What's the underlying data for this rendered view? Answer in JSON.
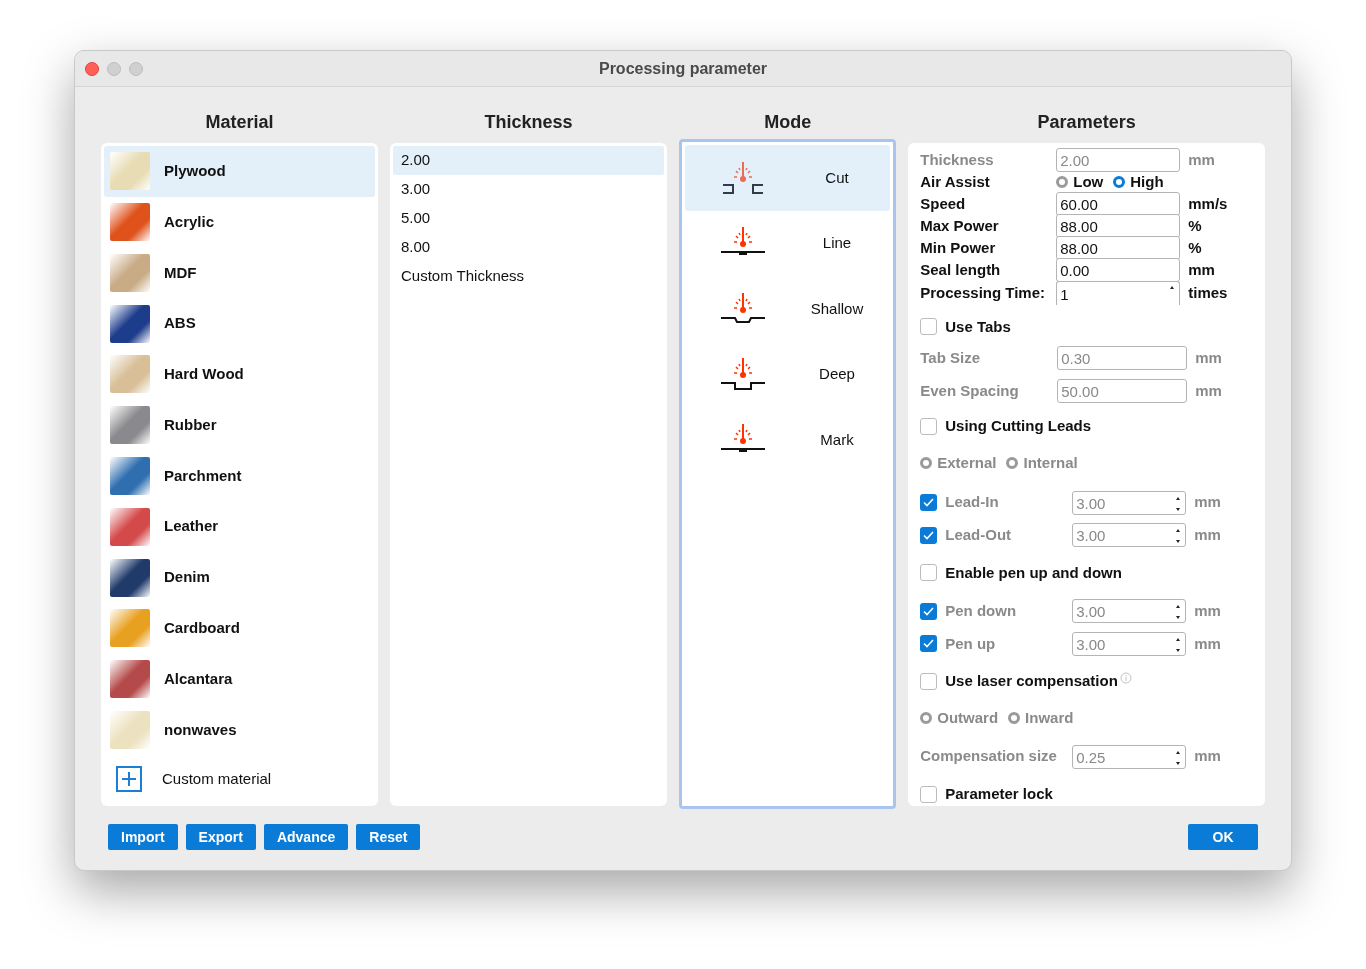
{
  "window": {
    "title": "Processing parameter"
  },
  "material": {
    "heading": "Material",
    "items": [
      {
        "name": "Plywood",
        "selected": true,
        "color": "#e8dcb4"
      },
      {
        "name": "Acrylic",
        "selected": false,
        "color": "#e0521c"
      },
      {
        "name": "MDF",
        "selected": false,
        "color": "#c9ac86"
      },
      {
        "name": "ABS",
        "selected": false,
        "color": "#1d3c8c"
      },
      {
        "name": "Hard Wood",
        "selected": false,
        "color": "#d8bf98"
      },
      {
        "name": "Rubber",
        "selected": false,
        "color": "#8a8a8e"
      },
      {
        "name": "Parchment",
        "selected": false,
        "color": "#2f6fb0"
      },
      {
        "name": "Leather",
        "selected": false,
        "color": "#d44a4a"
      },
      {
        "name": "Denim",
        "selected": false,
        "color": "#203a6a"
      },
      {
        "name": "Cardboard",
        "selected": false,
        "color": "#e8a020"
      },
      {
        "name": "Alcantara",
        "selected": false,
        "color": "#b54a4a"
      },
      {
        "name": "nonwaves",
        "selected": false,
        "color": "#ece2c0"
      }
    ],
    "custom": "Custom material"
  },
  "thickness": {
    "heading": "Thickness",
    "items": [
      {
        "label": "2.00",
        "selected": true
      },
      {
        "label": "3.00",
        "selected": false
      },
      {
        "label": "5.00",
        "selected": false
      },
      {
        "label": "8.00",
        "selected": false
      },
      {
        "label": "Custom Thickness",
        "selected": false
      }
    ]
  },
  "mode": {
    "heading": "Mode",
    "items": [
      {
        "name": "Cut",
        "kind": "cut",
        "selected": true
      },
      {
        "name": "Line",
        "kind": "line",
        "selected": false
      },
      {
        "name": "Shallow",
        "kind": "shallow",
        "selected": false
      },
      {
        "name": "Deep",
        "kind": "deep",
        "selected": false
      },
      {
        "name": "Mark",
        "kind": "mark",
        "selected": false
      }
    ]
  },
  "parameters": {
    "heading": "Parameters",
    "rows": [
      {
        "kind": "field",
        "label": "Thickness",
        "value": "2.00",
        "unit": "mm",
        "disabled": true
      },
      {
        "kind": "radio",
        "label": "Air Assist",
        "disabled": false,
        "options": [
          {
            "label": "Low",
            "selected": false
          },
          {
            "label": "High",
            "selected": true
          }
        ]
      },
      {
        "kind": "field",
        "label": "Speed",
        "value": "60.00",
        "unit": "mm/s",
        "disabled": false
      },
      {
        "kind": "field",
        "label": "Max Power",
        "value": "88.00",
        "unit": "%",
        "disabled": false
      },
      {
        "kind": "field",
        "label": "Min Power",
        "value": "88.00",
        "unit": "%",
        "disabled": false
      },
      {
        "kind": "field",
        "label": "Seal length",
        "value": "0.00",
        "unit": "mm",
        "disabled": false
      },
      {
        "kind": "spin",
        "label": "Processing Time:",
        "value": "1",
        "unit": "times",
        "disabled": false
      },
      {
        "kind": "checkbox",
        "label": "Use Tabs",
        "checked": false
      },
      {
        "kind": "field",
        "label": "Tab Size",
        "value": "0.30",
        "unit": "mm",
        "disabled": true
      },
      {
        "kind": "field",
        "label": "Even Spacing",
        "value": "50.00",
        "unit": "mm",
        "disabled": true
      },
      {
        "kind": "checkbox",
        "label": "Using Cutting Leads",
        "checked": false
      },
      {
        "kind": "radio",
        "disabled": true,
        "options": [
          {
            "label": "External",
            "selected": false
          },
          {
            "label": "Internal",
            "selected": false
          }
        ]
      },
      {
        "kind": "check_spin",
        "label": "Lead-In",
        "checked": true,
        "value": "3.00",
        "unit": "mm",
        "disabled": true
      },
      {
        "kind": "check_spin",
        "label": "Lead-Out",
        "checked": true,
        "value": "3.00",
        "unit": "mm",
        "disabled": true
      },
      {
        "kind": "checkbox",
        "label": "Enable pen up and down",
        "checked": false
      },
      {
        "kind": "check_spin",
        "label": "Pen down",
        "checked": true,
        "value": "3.00",
        "unit": "mm",
        "disabled": true
      },
      {
        "kind": "check_spin",
        "label": "Pen up",
        "checked": true,
        "value": "3.00",
        "unit": "mm",
        "disabled": true
      },
      {
        "kind": "checkbox",
        "label": "Use laser compensation",
        "checked": false,
        "info": true
      },
      {
        "kind": "radio",
        "disabled": true,
        "options": [
          {
            "label": "Outward",
            "selected": false
          },
          {
            "label": "Inward",
            "selected": false
          }
        ]
      },
      {
        "kind": "spin",
        "label": "Compensation size",
        "value": "0.25",
        "unit": "mm",
        "disabled": true
      },
      {
        "kind": "checkbox",
        "label": "Parameter lock",
        "checked": false
      }
    ]
  },
  "buttons": [
    "Import",
    "Export",
    "Advance",
    "Reset"
  ],
  "ok_button": "OK"
}
